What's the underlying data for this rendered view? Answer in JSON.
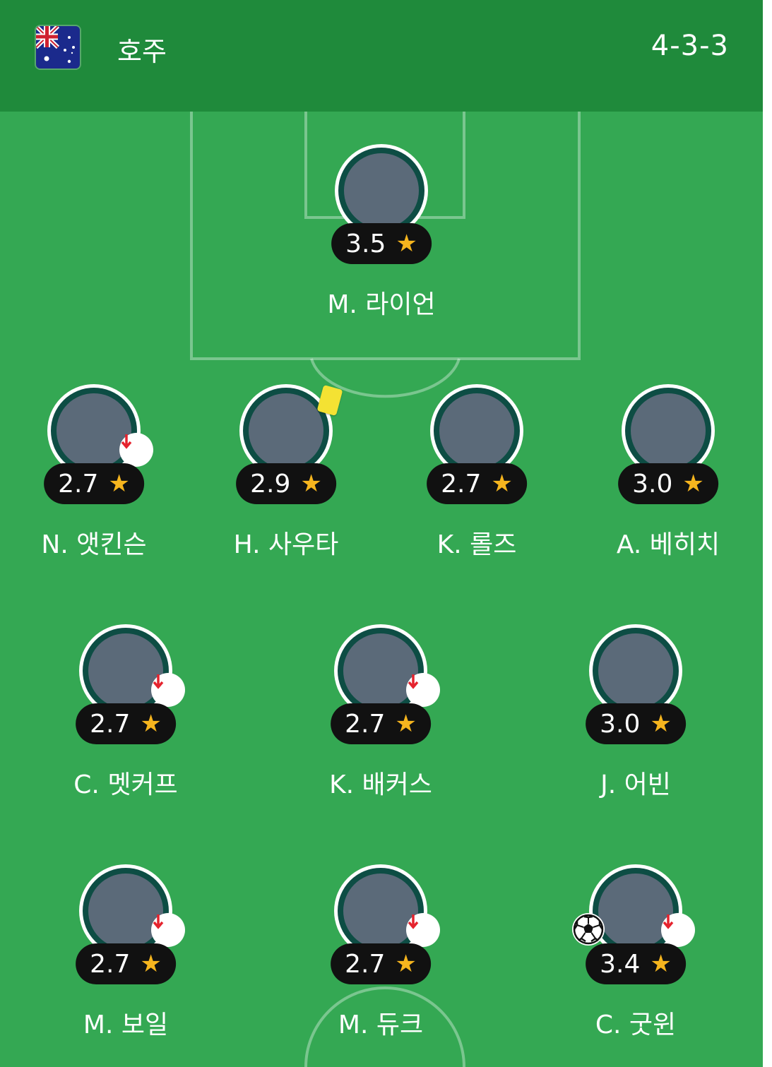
{
  "header": {
    "flag_icon": "australia-flag-icon",
    "team_name": "호주",
    "formation": "4-3-3"
  },
  "colors": {
    "pitch": "#34a853",
    "header": "#1f8a3b",
    "rating_bg": "#111111",
    "star": "#f6b51e",
    "sub_arrow": "#e5232e",
    "avatar_ring": "#0d4d44"
  },
  "players": {
    "gk": {
      "name": "M. 라이언",
      "rating": "3.5"
    },
    "d1": {
      "name": "N. 앳킨슨",
      "rating": "2.7",
      "subbed_off": true
    },
    "d2": {
      "name": "H. 사우타",
      "rating": "2.9",
      "yellow_card": true
    },
    "d3": {
      "name": "K. 롤즈",
      "rating": "2.7"
    },
    "d4": {
      "name": "A. 베히치",
      "rating": "3.0"
    },
    "m1": {
      "name": "C. 멧커프",
      "rating": "2.7",
      "subbed_off": true
    },
    "m2": {
      "name": "K. 배커스",
      "rating": "2.7",
      "subbed_off": true
    },
    "m3": {
      "name": "J. 어빈",
      "rating": "3.0"
    },
    "f1": {
      "name": "M. 보일",
      "rating": "2.7",
      "subbed_off": true
    },
    "f2": {
      "name": "M. 듀크",
      "rating": "2.7",
      "subbed_off": true
    },
    "f3": {
      "name": "C. 굿윈",
      "rating": "3.4",
      "subbed_off": true,
      "goal": true
    }
  },
  "star_glyph": "★"
}
